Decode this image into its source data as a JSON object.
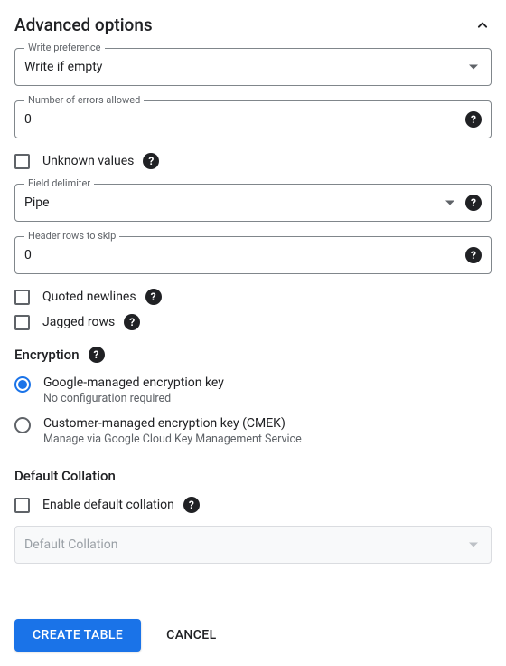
{
  "section": {
    "title": "Advanced options"
  },
  "write_pref": {
    "label": "Write preference",
    "value": "Write if empty"
  },
  "errors_allowed": {
    "label": "Number of errors allowed",
    "value": "0"
  },
  "unknown_values": {
    "label": "Unknown values"
  },
  "field_delimiter": {
    "label": "Field delimiter",
    "value": "Pipe"
  },
  "header_rows": {
    "label": "Header rows to skip",
    "value": "0"
  },
  "quoted_newlines": {
    "label": "Quoted newlines"
  },
  "jagged_rows": {
    "label": "Jagged rows"
  },
  "encryption": {
    "title": "Encryption",
    "google": {
      "label": "Google-managed encryption key",
      "sub": "No configuration required"
    },
    "cmek": {
      "label": "Customer-managed encryption key (CMEK)",
      "sub": "Manage via Google Cloud Key Management Service"
    }
  },
  "default_collation": {
    "title": "Default Collation",
    "enable_label": "Enable default collation",
    "select_placeholder": "Default Collation"
  },
  "footer": {
    "create": "CREATE TABLE",
    "cancel": "CANCEL"
  }
}
